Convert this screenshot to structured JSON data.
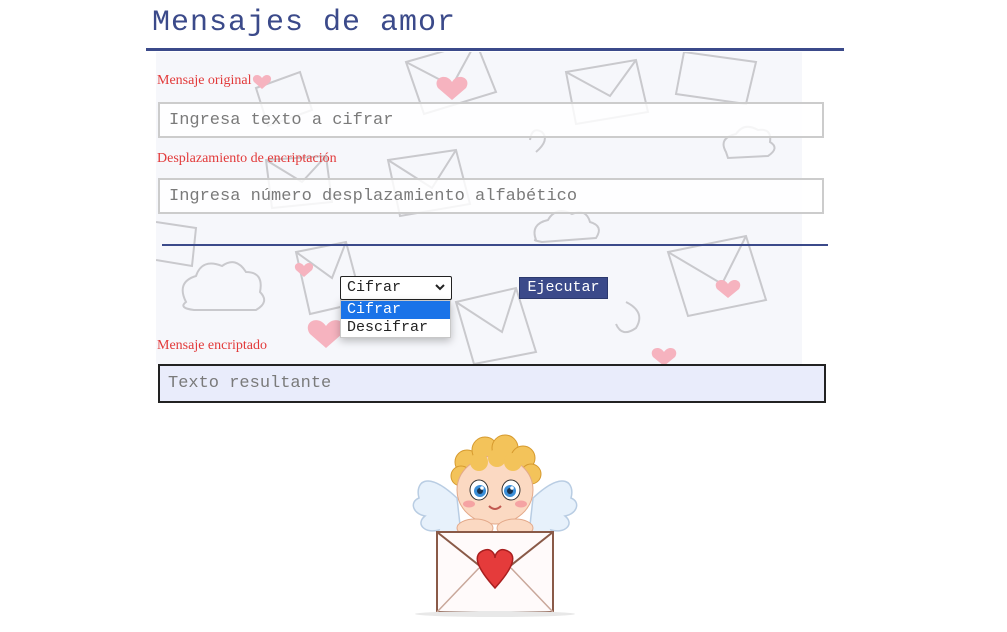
{
  "header": {
    "title": "Mensajes de amor"
  },
  "form": {
    "original_label": "Mensaje original",
    "original_placeholder": "Ingresa texto a cifrar",
    "shift_label": "Desplazamiento de encriptación",
    "shift_placeholder": "Ingresa número desplazamiento alfabético",
    "mode_selected": "Cifrar",
    "mode_options": [
      "Cifrar",
      "Descifrar"
    ],
    "run_label": "Ejecutar",
    "result_label": "Mensaje encriptado",
    "result_placeholder": "Texto resultante"
  },
  "colors": {
    "accent": "#3b4a8a",
    "label": "#e23a3a",
    "result_bg": "#e9ecfb",
    "option_highlight": "#1a73e8"
  },
  "icons": {
    "select_chevron": "chevron-down-icon",
    "illustration": "cupid-envelope-illustration"
  }
}
